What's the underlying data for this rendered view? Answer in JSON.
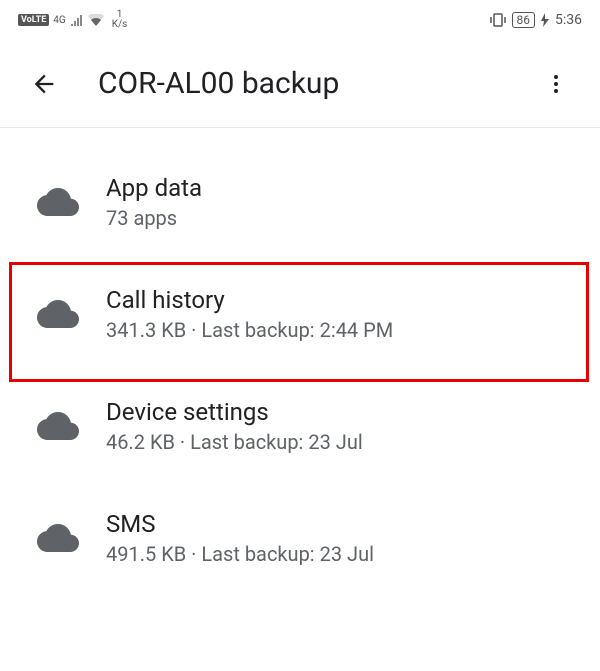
{
  "status_bar": {
    "volte": "VoLTE",
    "network": "4G",
    "speed_value": "1",
    "speed_unit": "K/s",
    "battery": "86",
    "time": "5:36"
  },
  "header": {
    "title": "COR-AL00 backup"
  },
  "items": [
    {
      "title": "App data",
      "subtitle": "73 apps"
    },
    {
      "title": "Call history",
      "subtitle": "341.3 KB · Last backup: 2:44 PM"
    },
    {
      "title": "Device settings",
      "subtitle": "46.2 KB · Last backup: 23 Jul"
    },
    {
      "title": "SMS",
      "subtitle": "491.5 KB · Last backup: 23 Jul"
    }
  ]
}
